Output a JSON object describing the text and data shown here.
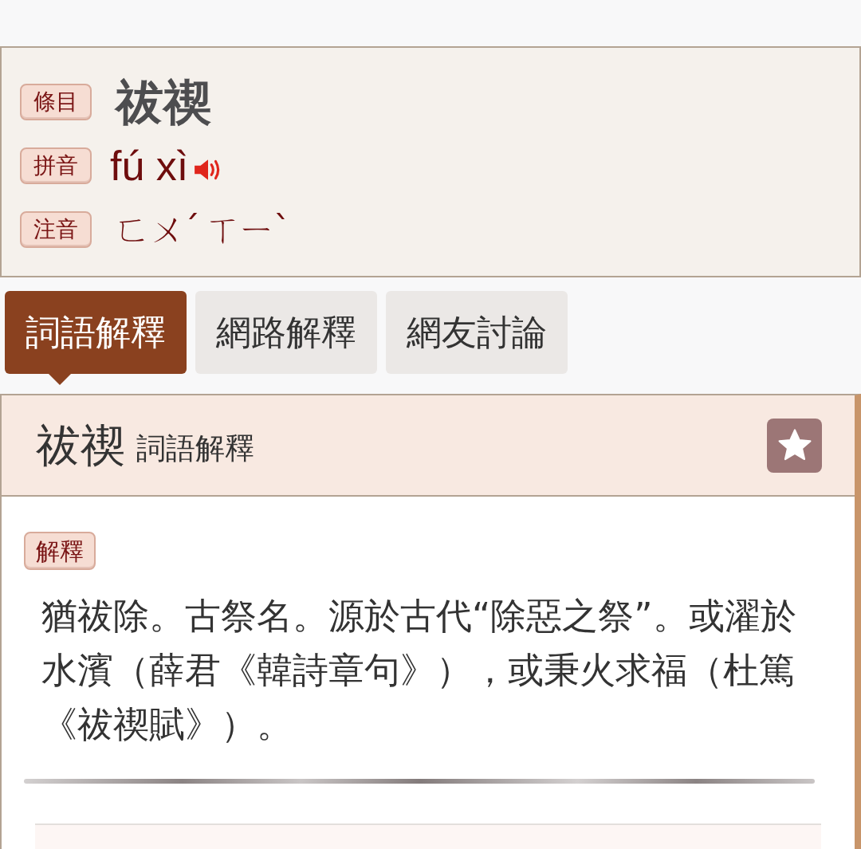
{
  "header_rows": [
    {
      "kind": "word",
      "label": "條目",
      "value": "祓禊"
    },
    {
      "kind": "pinyin",
      "label": "拼音",
      "value": "fú xì"
    },
    {
      "kind": "zhuyin",
      "label": "注音",
      "value": "ㄈㄨˊ ㄒㄧˋ"
    }
  ],
  "tabs": [
    {
      "label": "詞語解釋",
      "selected": true
    },
    {
      "label": "網路解釋",
      "selected": false
    },
    {
      "label": "網友討論",
      "selected": false
    }
  ],
  "definition_panel": {
    "title": "祓禊",
    "subtitle": "詞語解釋",
    "section_label": "解釋",
    "text": "猶祓除。古祭名。源於古代“除惡之祭”。或濯於水濱（薛君《韓詩章句》），或秉火求福（杜篤《祓禊賦》）。"
  }
}
